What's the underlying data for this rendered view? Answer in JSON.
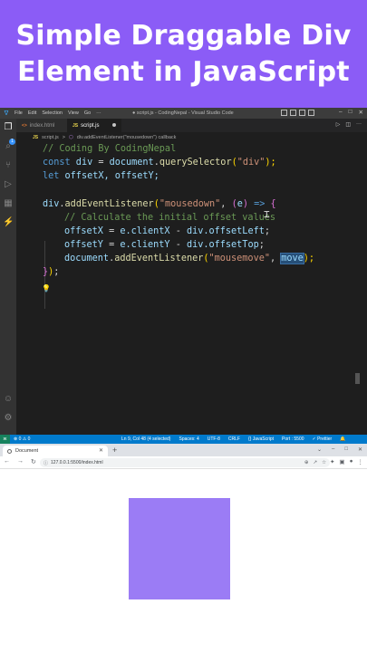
{
  "banner": {
    "line1": "Simple Draggable Div",
    "line2": "Element in JavaScript",
    "color": "#8b5cf6"
  },
  "vscode": {
    "menu": [
      "File",
      "Edit",
      "Selection",
      "View",
      "Go",
      "···"
    ],
    "window_title": "● script.js - CodingNepal - Visual Studio Code",
    "tabs": [
      {
        "icon_text": "<>",
        "label": "index.html",
        "active": false
      },
      {
        "icon_text": "JS",
        "label": "script.js",
        "active": true,
        "modified": true
      }
    ],
    "breadcrumb": {
      "file": "script.js",
      "separator1": ">",
      "symbol": "div.addEventListener(\"mousedown\") callback"
    },
    "code": {
      "line1": "// Coding By CodingNepal",
      "line2": {
        "kw": "const",
        "var": " div",
        "eq": " = ",
        "obj": "document",
        "dot": ".",
        "fn": "querySelector",
        "p1": "(",
        "str": "\"div\"",
        "p2": ");"
      },
      "line3": {
        "kw": "let",
        "vars": " offsetX, offsetY;"
      },
      "line5": {
        "obj": "div",
        "dot": ".",
        "fn": "addEventListener",
        "p1": "(",
        "str": "\"mousedown\"",
        "sep": ", ",
        "p2": "(",
        "arg": "e",
        "p3": ")",
        "arrow": " => ",
        "brace": "{"
      },
      "line6": "// Calculate the initial offset values",
      "line7": {
        "a": "offsetX",
        "eq": " = ",
        "b": "e",
        "c": ".clientX",
        "minus": " - ",
        "d": "div",
        "e": ".offsetLeft",
        "end": ";"
      },
      "line8": {
        "a": "offsetY",
        "eq": " = ",
        "b": "e",
        "c": ".clientY",
        "minus": " - ",
        "d": "div",
        "e": ".offsetTop",
        "end": ";"
      },
      "line9": {
        "obj": "document",
        "dot": ".",
        "fn": "addEventListener",
        "p1": "(",
        "str": "\"mousemove\"",
        "sep": ", ",
        "sel": "move",
        "p2": ");"
      },
      "line10": {
        "brace": "}",
        "paren": ")",
        "end": ";"
      }
    },
    "status": {
      "errors": "⊗ 0 ⚠ 0",
      "position": "Ln 9, Col 48 (4 selected)",
      "spaces": "Spaces: 4",
      "encoding": "UTF-8",
      "eol": "CRLF",
      "language": "{} JavaScript",
      "port": "Port : 5500",
      "prettier": "✓ Prettier"
    }
  },
  "browser": {
    "tab_title": "Document",
    "new_tab": "+",
    "url": "127.0.0.1:5500/index.html",
    "draggable_color": "#9b7cf5"
  }
}
